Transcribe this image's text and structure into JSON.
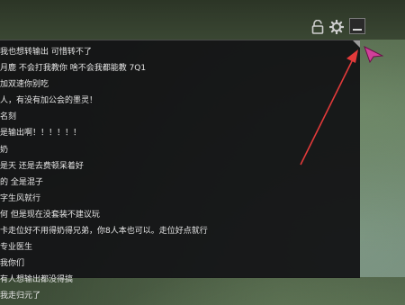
{
  "toolbar": {
    "lock_icon": "lock-icon",
    "settings_icon": "gear-icon",
    "minimize_icon": "minimize-icon"
  },
  "chat": {
    "messages": [
      "我也想转输出 可惜转不了",
      "月鹿 不会打我教你 啥不会我都能教 7Q1",
      "加双速你别吃",
      "人，有没有加公会的墨灵！",
      "名刻",
      "是输出啊！！！！！！",
      "奶",
      "是天 还是去费顿呆着好",
      "的 全是混子",
      "字生风就行",
      "何 但是现在没套装不建议玩",
      "卡走位好不用得奶得兄弟，你8人本也可以。走位好点就行",
      "专业医生",
      "我你们",
      "有人想输出都没得搞",
      "我走归元了"
    ]
  },
  "colors": {
    "panel_bg": "#121214",
    "text": "#e6e6e6",
    "annotation_arrow": "#e23a3a",
    "cursor": "#d0409a"
  }
}
